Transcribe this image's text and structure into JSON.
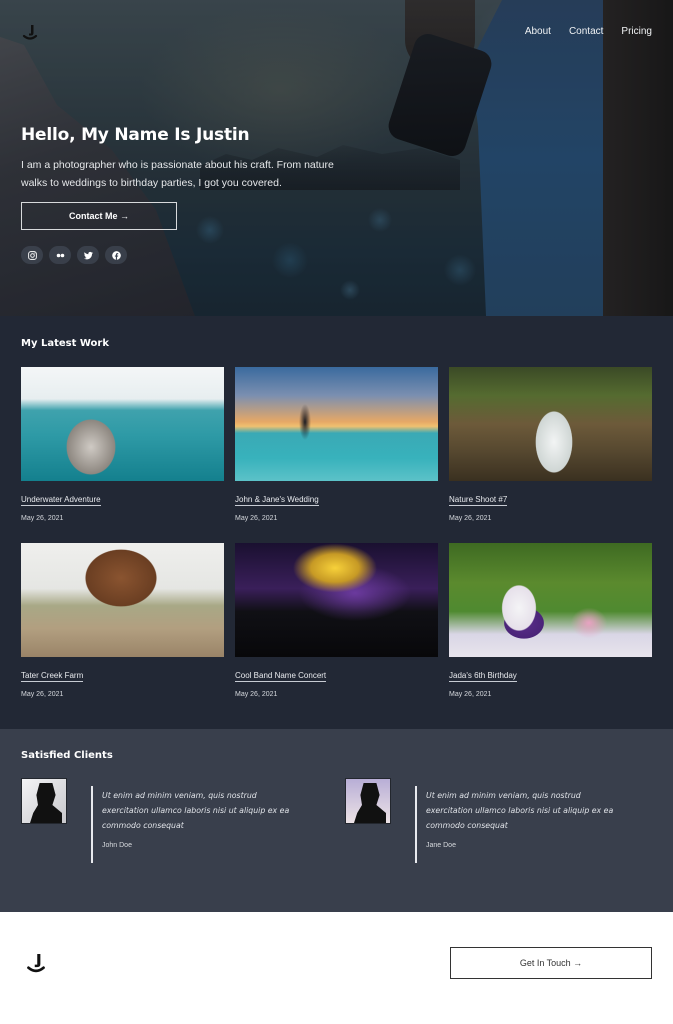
{
  "header": {
    "logo_alt": "J logo",
    "nav": [
      {
        "label": "About"
      },
      {
        "label": "Contact"
      },
      {
        "label": "Pricing"
      }
    ]
  },
  "hero": {
    "title": "Hello, My Name Is Justin",
    "description": "I am a photographer who is passionate about his craft. From nature walks to weddings to birthday parties, I got you covered.",
    "cta_label": "Contact Me →",
    "social": [
      {
        "icon": "instagram-icon"
      },
      {
        "icon": "flickr-icon"
      },
      {
        "icon": "twitter-icon"
      },
      {
        "icon": "facebook-icon"
      }
    ]
  },
  "work": {
    "title": "My Latest Work",
    "items": [
      {
        "title": "Underwater Adventure",
        "date": "May 26, 2021",
        "image": "sea lion underwater"
      },
      {
        "title": "John & Jane's Wedding",
        "date": "May 26, 2021",
        "image": "couple on beach at sunset"
      },
      {
        "title": "Nature Shoot #7",
        "date": "May 26, 2021",
        "image": "forest waterfall"
      },
      {
        "title": "Tater Creek Farm",
        "date": "May 26, 2021",
        "image": "goats at hay feeder"
      },
      {
        "title": "Cool Band Name Concert",
        "date": "May 26, 2021",
        "image": "concert crowd with stage lights"
      },
      {
        "title": "Jada's 6th Birthday",
        "date": "May 26, 2021",
        "image": "teddy bear with gift"
      }
    ]
  },
  "clients": {
    "title": "Satisfied Clients",
    "testimonials": [
      {
        "quote": "Ut enim ad minim veniam, quis nostrud exercitation ullamco laboris nisi ut aliquip ex ea commodo consequat",
        "author": "John Doe"
      },
      {
        "quote": "Ut enim ad minim veniam, quis nostrud exercitation ullamco laboris nisi ut aliquip ex ea commodo consequat",
        "author": "Jane Doe"
      }
    ]
  },
  "footer": {
    "cta_label": "Get In Touch →"
  },
  "colors": {
    "work_bg": "#222835",
    "clients_bg": "#393f4c",
    "footer_bg": "#ffffff"
  }
}
